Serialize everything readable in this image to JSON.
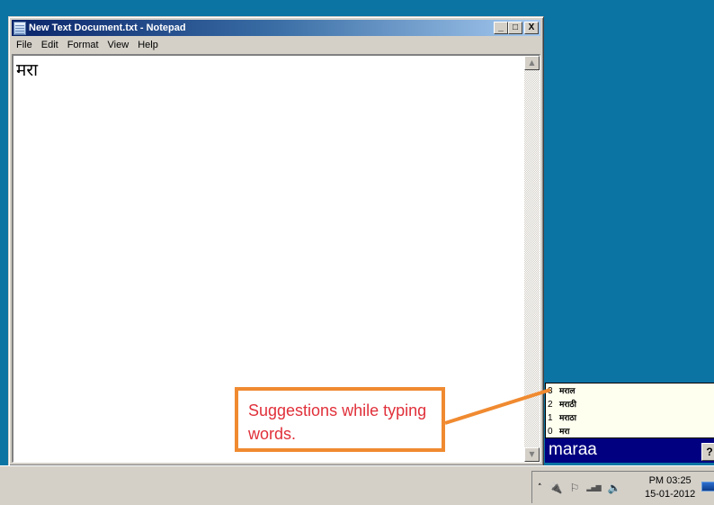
{
  "window": {
    "title": "New Text Document.txt - Notepad",
    "controls": {
      "minimize": "_",
      "maximize": "□",
      "close": "X"
    },
    "menu": [
      "File",
      "Edit",
      "Format",
      "View",
      "Help"
    ],
    "editor_content": "मरा",
    "scroll_up_glyph": "▲",
    "scroll_down_glyph": "▼"
  },
  "ime": {
    "suggestions": [
      {
        "index": "3",
        "word": "मराल"
      },
      {
        "index": "2",
        "word": "मराठी"
      },
      {
        "index": "1",
        "word": "मराठा"
      },
      {
        "index": "0",
        "word": "मरा"
      }
    ],
    "input": "maraa",
    "help_label": "?"
  },
  "callout": {
    "text": "Suggestions while typing words.",
    "border_color": "#f08a30",
    "text_color": "#e0303a"
  },
  "taskbar": {
    "tray_icons": [
      "show-hidden-icons",
      "power-icon",
      "action-center-flag-icon",
      "network-signal-icon",
      "volume-icon"
    ],
    "tray_glyphs": {
      "chevron": "˄",
      "power": "🔌",
      "flag": "⚐",
      "signal": "▂▄▆",
      "volume": "🔈"
    },
    "time": "PM 03:25",
    "date": "15-01-2012"
  }
}
